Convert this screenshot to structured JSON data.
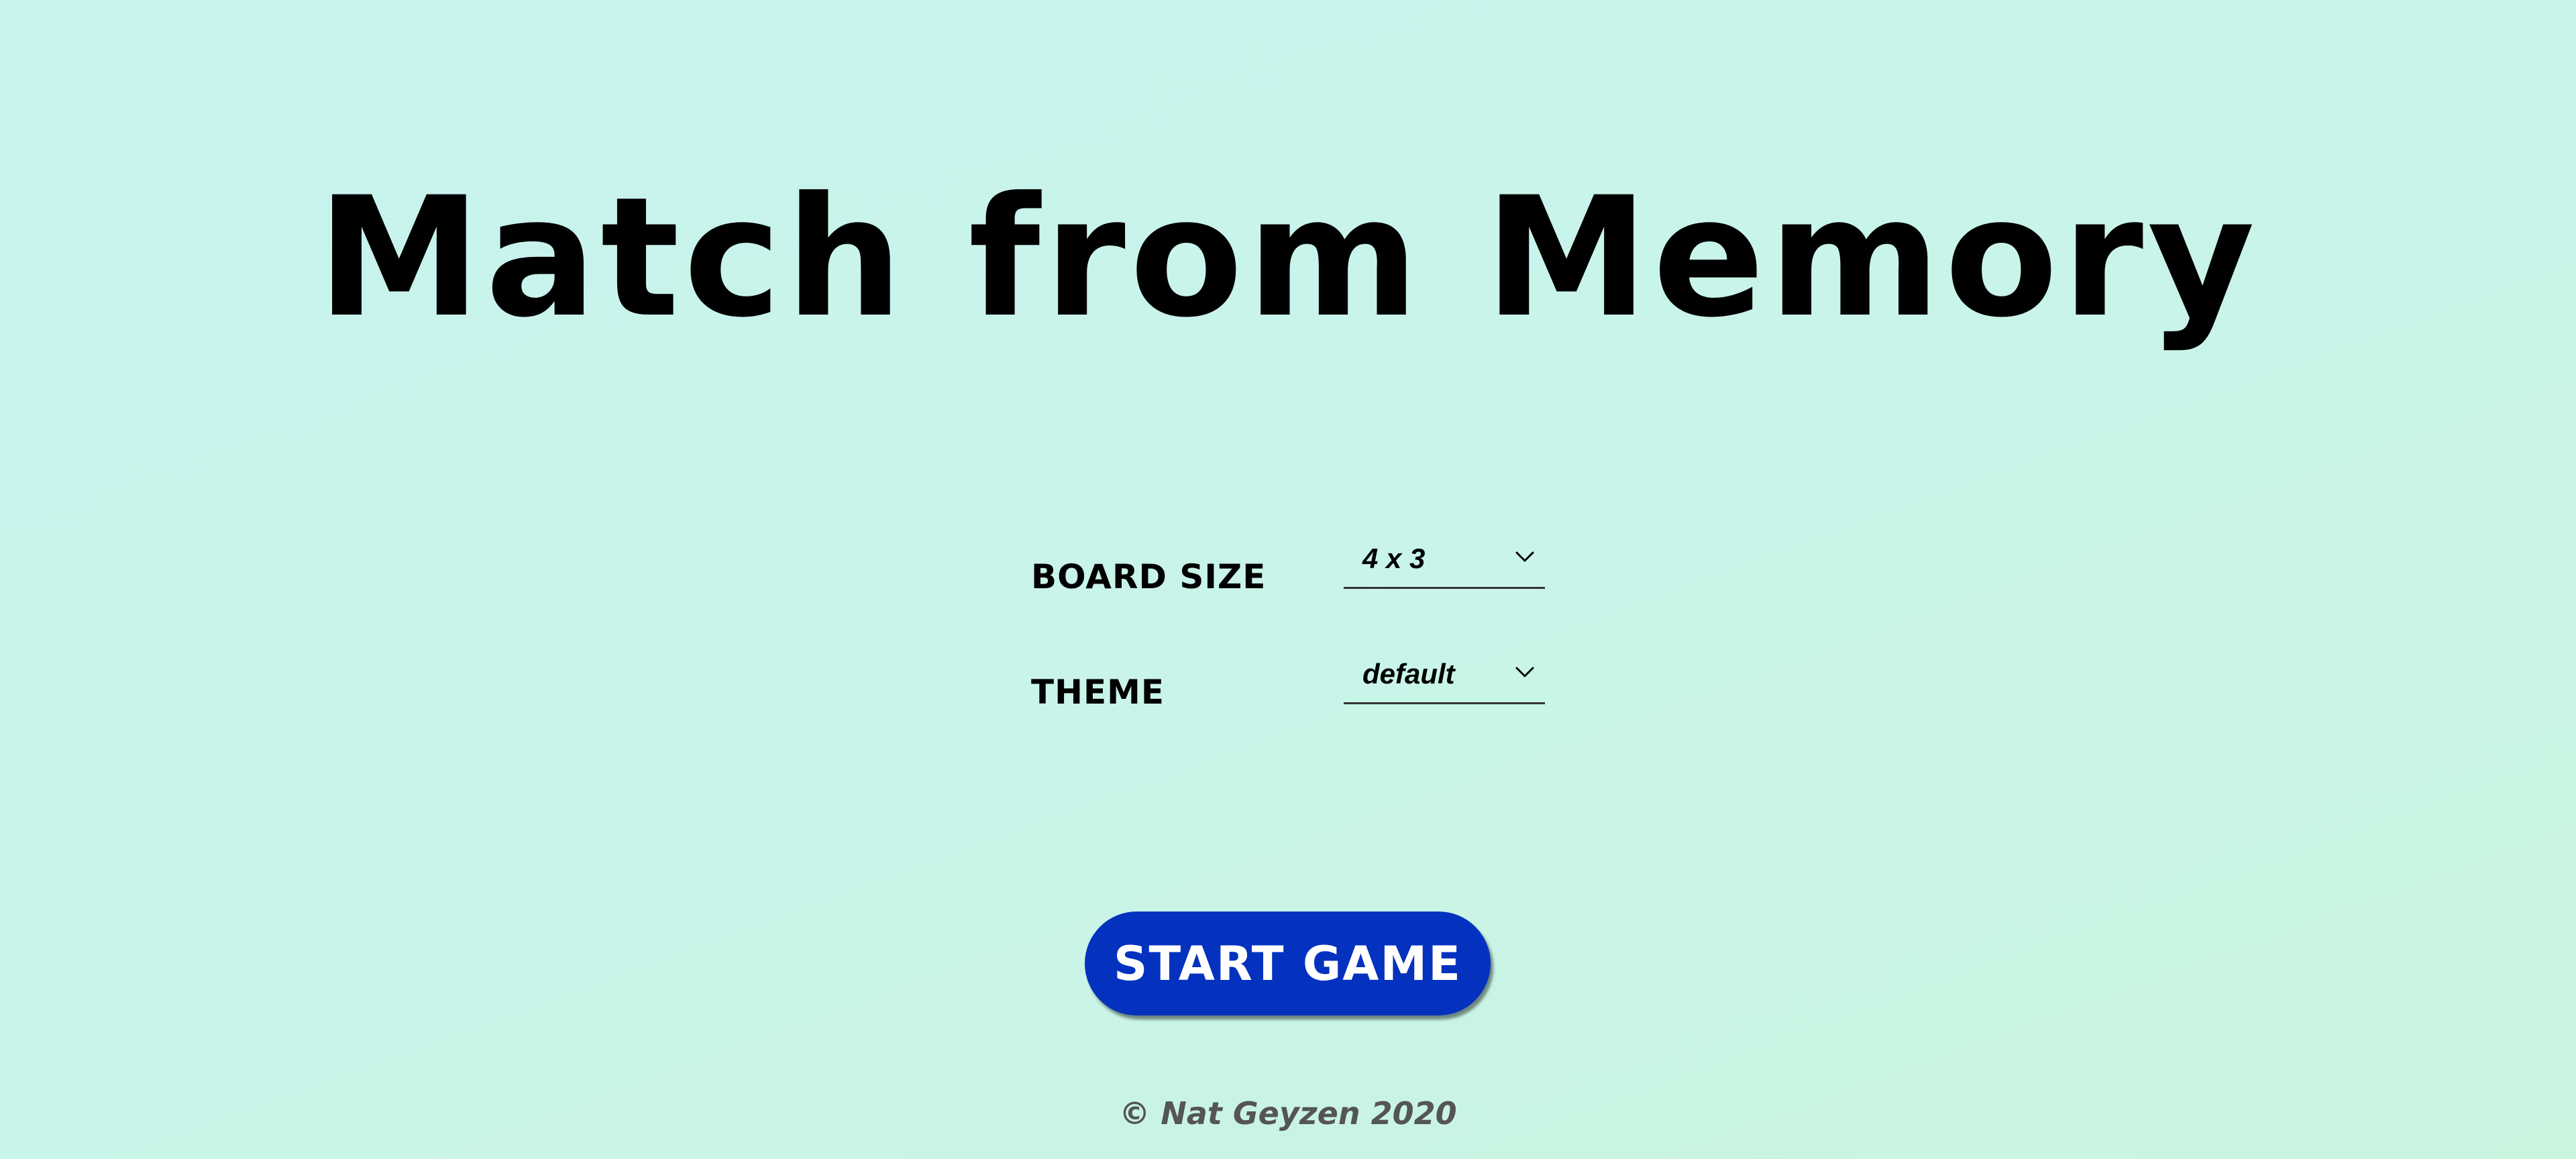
{
  "game": {
    "title": "Match from Memory",
    "settings": {
      "board_size": {
        "label": "BOARD SIZE",
        "selected": "4 x 3"
      },
      "theme": {
        "label": "THEME",
        "selected": "default"
      }
    },
    "start_button_label": "START GAME",
    "footer": "© Nat Geyzen 2020"
  },
  "icons": {
    "dropdown": "chevron-down-icon"
  },
  "colors": {
    "background_start": "#c8f3ef",
    "background_end": "#c9f5df",
    "button": "#0432bf",
    "button_text": "#ffffff",
    "footer_text": "#555555"
  }
}
